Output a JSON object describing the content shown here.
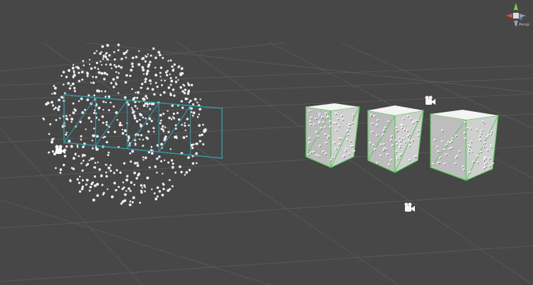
{
  "viewport": {
    "projection_label": "< Persp",
    "background": "#474747",
    "grid_color": "#5c5c5c",
    "particle_color": "#f2f2f2",
    "wire_cyan": "#2aa6b3",
    "wire_green": "#4fd04f",
    "cube_face": "#bdbdbd",
    "cube_top": "#f4f4f4"
  },
  "icons": {
    "camera": "camera-icon",
    "gizmo": "scene-orientation-gizmo-icon"
  }
}
